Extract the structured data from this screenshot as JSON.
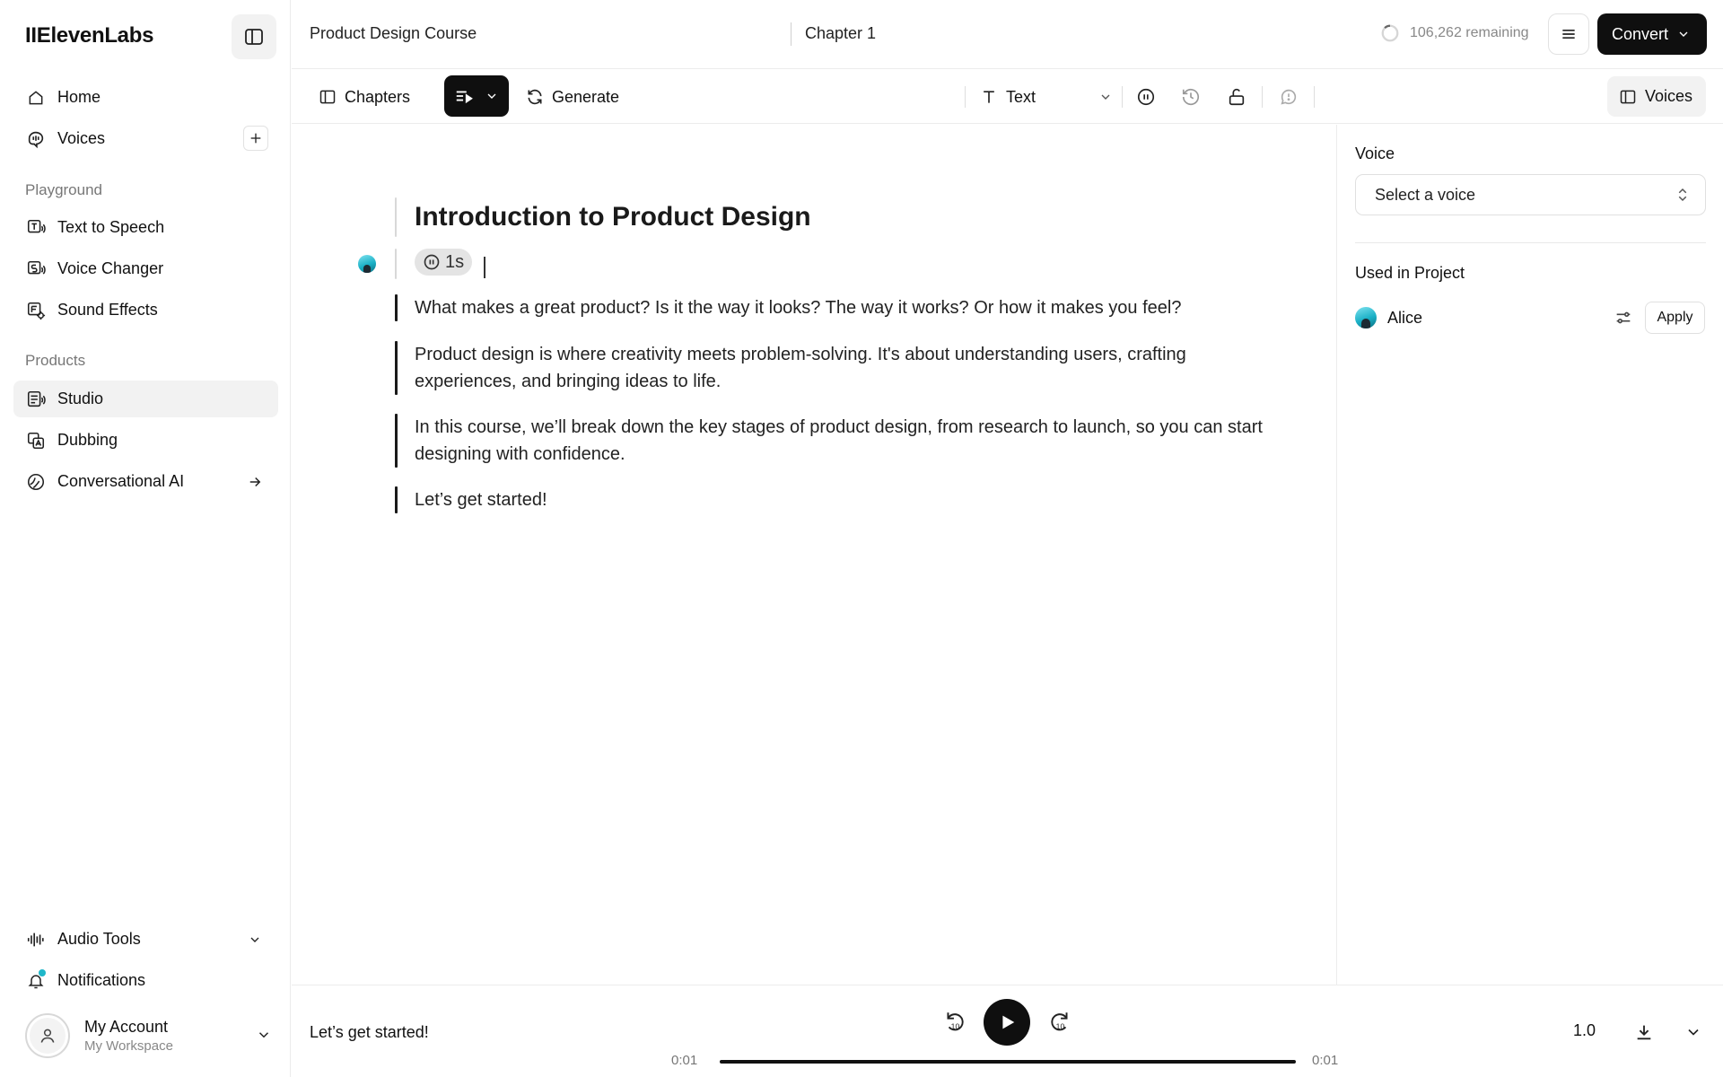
{
  "brand": {
    "logo": "IIElevenLabs"
  },
  "sidebar": {
    "top_items": [
      {
        "label": "Home",
        "icon": "home-icon"
      },
      {
        "label": "Voices",
        "icon": "voices-icon"
      }
    ],
    "playground_label": "Playground",
    "playground_items": [
      {
        "label": "Text to Speech",
        "icon": "text-to-speech-icon"
      },
      {
        "label": "Voice Changer",
        "icon": "voice-changer-icon"
      },
      {
        "label": "Sound Effects",
        "icon": "sound-effects-icon"
      }
    ],
    "products_label": "Products",
    "products_items": [
      {
        "label": "Studio",
        "icon": "studio-icon",
        "active": true
      },
      {
        "label": "Dubbing",
        "icon": "dubbing-icon"
      },
      {
        "label": "Conversational AI",
        "icon": "conversational-ai-icon"
      }
    ],
    "bottom_items": [
      {
        "label": "Audio Tools",
        "icon": "audio-tools-icon"
      },
      {
        "label": "Notifications",
        "icon": "bell-icon"
      }
    ],
    "account": {
      "name": "My Account",
      "workspace": "My Workspace"
    }
  },
  "header": {
    "breadcrumb": [
      "Product Design Course",
      "Chapter 1"
    ],
    "remaining": "106,262 remaining",
    "convert_label": "Convert"
  },
  "toolbar": {
    "chapters_label": "Chapters",
    "generate_label": "Generate",
    "text_type_label": "Text",
    "voices_label": "Voices"
  },
  "editor": {
    "title": "Introduction to Product Design",
    "pause_label": "1s",
    "paragraphs": [
      "What makes a great product? Is it the way it looks? The way it works? Or how it makes you feel?",
      "Product design is where creativity meets problem-solving. It's about understanding users, crafting experiences, and bringing ideas to life.",
      "In this course, we’ll break down the key stages of product design, from research to launch, so you can start designing with confidence.",
      "Let’s get started!"
    ]
  },
  "right_panel": {
    "voice_label": "Voice",
    "voice_select_placeholder": "Select a voice",
    "used_in_project_label": "Used in Project",
    "voices": [
      {
        "name": "Alice",
        "apply_label": "Apply"
      }
    ]
  },
  "player": {
    "now_playing": "Let’s get started!",
    "time_current": "0:01",
    "time_total": "0:01",
    "progress": 1.0,
    "speed": "1.0"
  },
  "colors": {
    "accent_dark": "#0f0f0f",
    "voice_avatar": "#1ab0c6",
    "notif_dot": "#1fb7c9"
  }
}
